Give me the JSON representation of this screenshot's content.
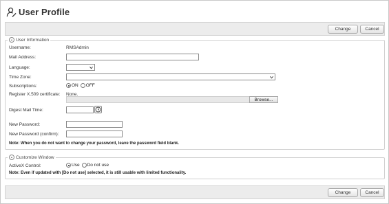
{
  "page": {
    "title": "User Profile"
  },
  "toolbar": {
    "change_label": "Change",
    "cancel_label": "Cancel"
  },
  "user_info": {
    "legend": "User Information",
    "username_label": "Username:",
    "username_value": "RMSAdmin",
    "mail_label": "Mail Address:",
    "mail_value": "",
    "language_label": "Language:",
    "language_value": "",
    "timezone_label": "Time Zone:",
    "timezone_value": "",
    "subscriptions_label": "Subscriptions:",
    "subscriptions_on": "ON",
    "subscriptions_off": "OFF",
    "subscriptions_selected": "ON",
    "cert_label": "Register X.509 certificate:",
    "cert_value": "None.",
    "browse_label": "Browse...",
    "digest_label": "Digest Mail Time:",
    "digest_value": "",
    "newpw_label": "New Password:",
    "newpw_confirm_label": "New Password (confirm):",
    "note": "Note: When you do not want to change your password, leave the password field blank."
  },
  "customize": {
    "legend": "Customize Window",
    "activex_label": "ActiveX Control:",
    "use_label": "Use",
    "donotuse_label": "Do not use",
    "activex_selected": "Use",
    "note": "Note: Even if updated with [Do not use] selected, it is still usable with limited functionality."
  },
  "icons": {
    "title_icon": "user-profile-icon",
    "collapse_icon": "collapse-up-icon",
    "clock_icon": "clock-icon",
    "dropdown_icon": "chevron-down-icon"
  }
}
